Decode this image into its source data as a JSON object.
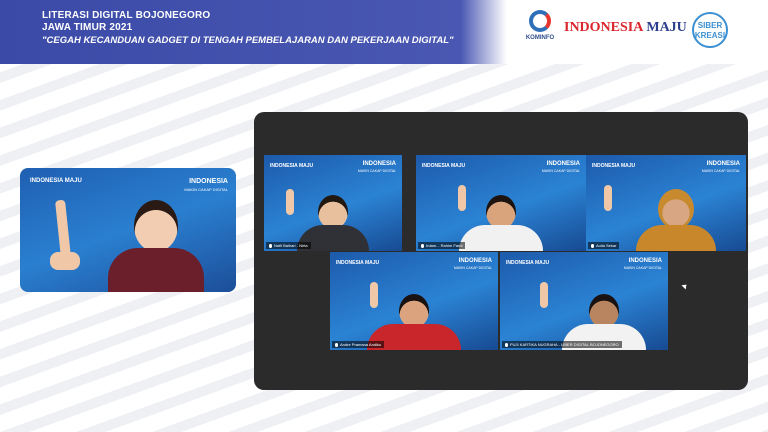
{
  "banner": {
    "line1": "LITERASI DIGITAL BOJONEGORO",
    "line2": "JAWA TIMUR 2021",
    "line3": "\"CEGAH KECANDUAN GADGET DI TENGAH PEMBELAJARAN DAN PEKERJAAN DIGITAL\""
  },
  "logos": {
    "kominfo": "KOMINFO",
    "indonesia": "INDONESIA",
    "maju": "MAJU",
    "siber_line1": "SIBER",
    "siber_line2": "KREASI"
  },
  "tile_text": {
    "brand": "INDONESIA",
    "brand_sub": "MAKIN CAKAP DIGITAL",
    "logo": "INDONESIA MAJU"
  },
  "participants": [
    "Nafil Baihari - Nirta",
    "Irdam... Rahim Farid",
    "Aulia Sekar",
    "Andre Pramana Andiku",
    "PUJI KARTIKA NUGRAHA - LIBER DIGITAL BOJONEGORO"
  ],
  "colors": {
    "banner": "#3a4aa6",
    "tile_bg": "#1d5aab",
    "panel": "#2b2b2b"
  }
}
